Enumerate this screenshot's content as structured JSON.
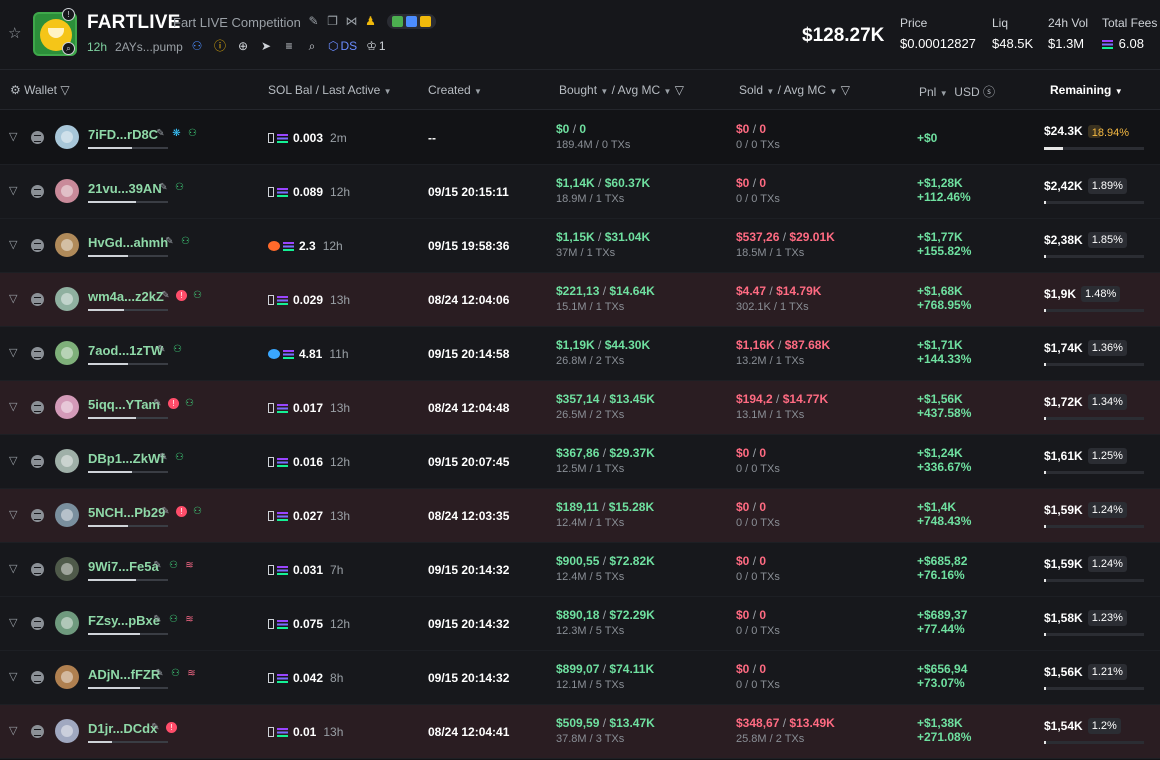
{
  "token": {
    "name": "FARTLIVE",
    "full_name": "Fart LIVE Competition",
    "age": "12h",
    "address": "2AYs...pump",
    "ds_label": "DS",
    "crown_count": "1"
  },
  "stats": {
    "market_cap": "$128.27K",
    "price_label": "Price",
    "price": "$0.00012827",
    "liq_label": "Liq",
    "liq": "$48.5K",
    "vol_label": "24h Vol",
    "vol": "$1.3M",
    "fees_label": "Total Fees",
    "fees": "6.08"
  },
  "columns": {
    "wallet": "Wallet",
    "sol_bal": "SOL Bal",
    "last_active": "Last Active",
    "created": "Created",
    "bought": "Bought",
    "bought_avg": "Avg MC",
    "sold": "Sold",
    "sold_avg": "Avg MC",
    "pnl": "Pnl",
    "usd": "USD",
    "remaining": "Remaining"
  },
  "rows": [
    {
      "wallet": "7iFD...rD8C",
      "sol": "0.003",
      "last": "2m",
      "created": "--",
      "bought": "$0",
      "bought_mc": "0",
      "bought_sub": "189.4M / 0 TXs",
      "sold": "$0",
      "sold_mc": "0",
      "sold_sub": "0 / 0 TXs",
      "pnl": "+$0",
      "pnl_pct": "",
      "remaining": "$24.3K",
      "rem_pct": "18.94%",
      "rem_fill": 0.19
    },
    {
      "wallet": "21vu...39AN",
      "sol": "0.089",
      "last": "12h",
      "created": "09/15 20:15:11",
      "bought": "$1,14K",
      "bought_mc": "$60.37K",
      "bought_sub": "18.9M / 1 TXs",
      "sold": "$0",
      "sold_mc": "0",
      "sold_sub": "0 / 0 TXs",
      "pnl": "+$1,28K",
      "pnl_pct": "+112.46%",
      "remaining": "$2,42K",
      "rem_pct": "1.89%",
      "rem_fill": 0.02
    },
    {
      "wallet": "HvGd...ahmh",
      "sol": "2.3",
      "last": "12h",
      "created": "09/15 19:58:36",
      "bought": "$1,15K",
      "bought_mc": "$31.04K",
      "bought_sub": "37M / 1 TXs",
      "sold": "$537,26",
      "sold_mc": "$29.01K",
      "sold_sub": "18.5M / 1 TXs",
      "pnl": "+$1,77K",
      "pnl_pct": "+155.82%",
      "remaining": "$2,38K",
      "rem_pct": "1.85%",
      "rem_fill": 0.02
    },
    {
      "wallet": "wm4a...z2kZ",
      "sol": "0.029",
      "last": "13h",
      "created": "08/24 12:04:06",
      "bought": "$221,13",
      "bought_mc": "$14.64K",
      "bought_sub": "15.1M / 1 TXs",
      "sold": "$4.47",
      "sold_mc": "$14.79K",
      "sold_sub": "302.1K / 1 TXs",
      "pnl": "+$1,68K",
      "pnl_pct": "+768.95%",
      "remaining": "$1,9K",
      "rem_pct": "1.48%",
      "rem_fill": 0.015
    },
    {
      "wallet": "7aod...1zTW",
      "sol": "4.81",
      "last": "11h",
      "created": "09/15 20:14:58",
      "bought": "$1,19K",
      "bought_mc": "$44.30K",
      "bought_sub": "26.8M / 2 TXs",
      "sold": "$1,16K",
      "sold_mc": "$87.68K",
      "sold_sub": "13.2M / 1 TXs",
      "pnl": "+$1,71K",
      "pnl_pct": "+144.33%",
      "remaining": "$1,74K",
      "rem_pct": "1.36%",
      "rem_fill": 0.014
    },
    {
      "wallet": "5iqq...YTam",
      "sol": "0.017",
      "last": "13h",
      "created": "08/24 12:04:48",
      "bought": "$357,14",
      "bought_mc": "$13.45K",
      "bought_sub": "26.5M / 2 TXs",
      "sold": "$194,2",
      "sold_mc": "$14.77K",
      "sold_sub": "13.1M / 1 TXs",
      "pnl": "+$1,56K",
      "pnl_pct": "+437.58%",
      "remaining": "$1,72K",
      "rem_pct": "1.34%",
      "rem_fill": 0.013
    },
    {
      "wallet": "DBp1...ZkWf",
      "sol": "0.016",
      "last": "12h",
      "created": "09/15 20:07:45",
      "bought": "$367,86",
      "bought_mc": "$29.37K",
      "bought_sub": "12.5M / 1 TXs",
      "sold": "$0",
      "sold_mc": "0",
      "sold_sub": "0 / 0 TXs",
      "pnl": "+$1,24K",
      "pnl_pct": "+336.67%",
      "remaining": "$1,61K",
      "rem_pct": "1.25%",
      "rem_fill": 0.013
    },
    {
      "wallet": "5NCH...Pb29",
      "sol": "0.027",
      "last": "13h",
      "created": "08/24 12:03:35",
      "bought": "$189,11",
      "bought_mc": "$15.28K",
      "bought_sub": "12.4M / 1 TXs",
      "sold": "$0",
      "sold_mc": "0",
      "sold_sub": "0 / 0 TXs",
      "pnl": "+$1,4K",
      "pnl_pct": "+748.43%",
      "remaining": "$1,59K",
      "rem_pct": "1.24%",
      "rem_fill": 0.012
    },
    {
      "wallet": "9Wi7...Fe5a",
      "sol": "0.031",
      "last": "7h",
      "created": "09/15 20:14:32",
      "bought": "$900,55",
      "bought_mc": "$72.82K",
      "bought_sub": "12.4M / 5 TXs",
      "sold": "$0",
      "sold_mc": "0",
      "sold_sub": "0 / 0 TXs",
      "pnl": "+$685,82",
      "pnl_pct": "+76.16%",
      "remaining": "$1,59K",
      "rem_pct": "1.24%",
      "rem_fill": 0.012
    },
    {
      "wallet": "FZsy...pBxe",
      "sol": "0.075",
      "last": "12h",
      "created": "09/15 20:14:32",
      "bought": "$890,18",
      "bought_mc": "$72.29K",
      "bought_sub": "12.3M / 5 TXs",
      "sold": "$0",
      "sold_mc": "0",
      "sold_sub": "0 / 0 TXs",
      "pnl": "+$689,37",
      "pnl_pct": "+77.44%",
      "remaining": "$1,58K",
      "rem_pct": "1.23%",
      "rem_fill": 0.012
    },
    {
      "wallet": "ADjN...fFZR",
      "sol": "0.042",
      "last": "8h",
      "created": "09/15 20:14:32",
      "bought": "$899,07",
      "bought_mc": "$74.11K",
      "bought_sub": "12.1M / 5 TXs",
      "sold": "$0",
      "sold_mc": "0",
      "sold_sub": "0 / 0 TXs",
      "pnl": "+$656,94",
      "pnl_pct": "+73.07%",
      "remaining": "$1,56K",
      "rem_pct": "1.21%",
      "rem_fill": 0.012
    },
    {
      "wallet": "D1jr...DCdx",
      "sol": "0.01",
      "last": "13h",
      "created": "08/24 12:04:41",
      "bought": "$509,59",
      "bought_mc": "$13.47K",
      "bought_sub": "37.8M / 3 TXs",
      "sold": "$348,67",
      "sold_mc": "$13.49K",
      "sold_sub": "25.8M / 2 TXs",
      "pnl": "+$1,38K",
      "pnl_pct": "+271.08%",
      "remaining": "$1,54K",
      "rem_pct": "1.2%",
      "rem_fill": 0.012
    }
  ]
}
